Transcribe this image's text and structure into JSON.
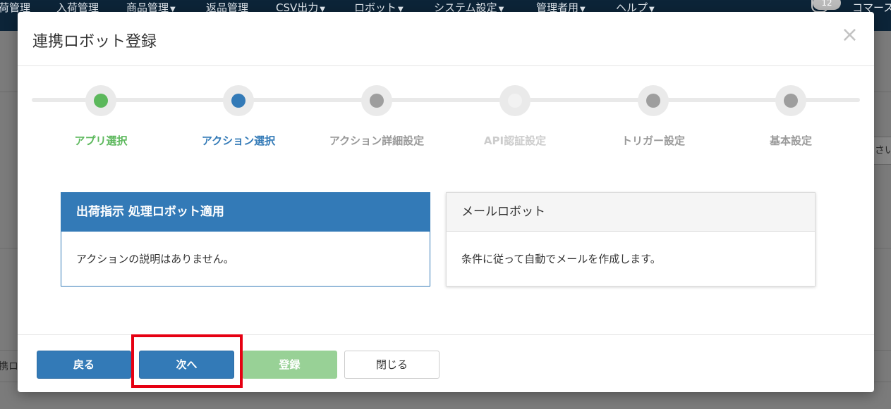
{
  "background": {
    "nav": [
      {
        "label": "荷管理",
        "caret": false
      },
      {
        "label": "入荷管理",
        "caret": false
      },
      {
        "label": "商品管理",
        "caret": true
      },
      {
        "label": "返品管理",
        "caret": false
      },
      {
        "label": "CSV出力",
        "caret": true
      },
      {
        "label": "ロボット",
        "caret": true
      },
      {
        "label": "システム設定",
        "caret": true
      },
      {
        "label": "管理者用",
        "caret": true
      },
      {
        "label": "ヘルプ",
        "caret": true
      }
    ],
    "notification_count": "12",
    "user_label": "コマース",
    "row_text": "携ロ",
    "field_text": "さい"
  },
  "modal": {
    "title": "連携ロボット登録",
    "close_symbol": "×",
    "steps": [
      {
        "label": "アプリ選択",
        "state": "done"
      },
      {
        "label": "アクション選択",
        "state": "active"
      },
      {
        "label": "アクション詳細設定",
        "state": "pending"
      },
      {
        "label": "API認証設定",
        "state": "disabled"
      },
      {
        "label": "トリガー設定",
        "state": "pending"
      },
      {
        "label": "基本設定",
        "state": "pending"
      }
    ],
    "actions": [
      {
        "title": "出荷指示 処理ロボット適用",
        "description": "アクションの説明はありません。",
        "selected": true
      },
      {
        "title": "メールロボット",
        "description": "条件に従って自動でメールを作成します。",
        "selected": false
      }
    ],
    "buttons": {
      "back": "戻る",
      "next": "次へ",
      "register": "登録",
      "close": "閉じる"
    }
  },
  "colors": {
    "primary": "#337ab7",
    "done": "#5cb85c",
    "pending": "#9e9e9e",
    "disabled": "#f2f2f2",
    "highlight": "#e60012"
  }
}
